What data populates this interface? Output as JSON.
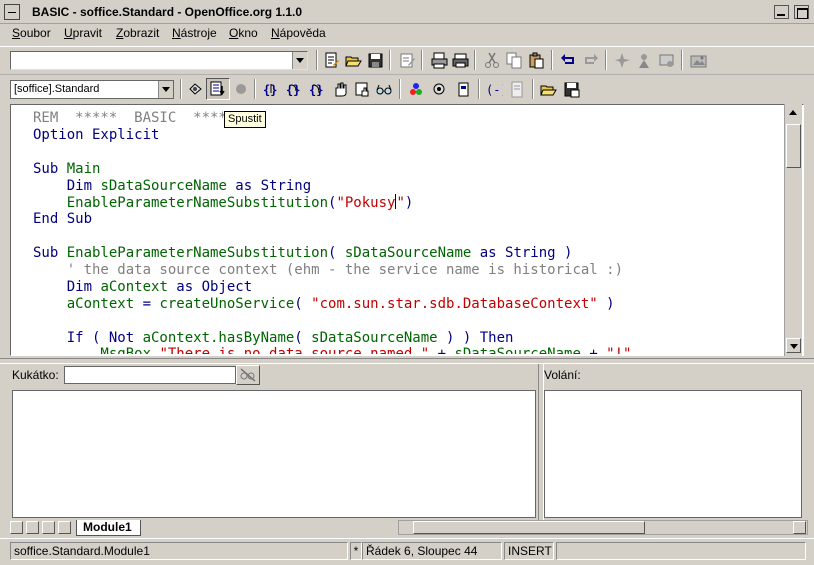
{
  "window": {
    "title": "BASIC - soffice.Standard - OpenOffice.org 1.1.0"
  },
  "menu": [
    {
      "label": "Soubor",
      "mnemonic": "S"
    },
    {
      "label": "Upravit",
      "mnemonic": "U"
    },
    {
      "label": "Zobrazit",
      "mnemonic": "Z"
    },
    {
      "label": "Nástroje",
      "mnemonic": "N"
    },
    {
      "label": "Okno",
      "mnemonic": "O"
    },
    {
      "label": "Nápověda",
      "mnemonic": "N"
    }
  ],
  "toolbar1": {
    "url_value": "",
    "icons": [
      "edit-file-icon",
      "open-icon",
      "save-icon",
      "edit-mode-icon",
      "print-file-icon",
      "print-icon",
      "cut-icon",
      "copy-icon",
      "paste-icon",
      "undo-icon",
      "redo-icon",
      "navigator-icon",
      "stylist-icon",
      "sources-icon",
      "gallery-icon"
    ]
  },
  "toolbar2": {
    "library_selected": "[soffice].Standard",
    "icons": [
      "compile-icon",
      "run-icon",
      "stop-icon",
      "step-procedure-icon",
      "step-into-icon",
      "step-out-icon",
      "breakpoint-icon",
      "manage-breakpoints-icon",
      "watch-icon",
      "find-parentheses-icon",
      "select-macro-icon",
      "modules-icon",
      "select-icon",
      "insert-source-icon",
      "save-source-icon"
    ]
  },
  "tooltip": "Spustit",
  "code_lines": [
    [
      {
        "t": "REM  *****  BASIC  *****",
        "c": "cm"
      }
    ],
    [
      {
        "t": "Option Explicit",
        "c": "kw"
      }
    ],
    [],
    [
      {
        "t": "Sub ",
        "c": "kw"
      },
      {
        "t": "Main",
        "c": "id"
      }
    ],
    [
      {
        "t": "    Dim ",
        "c": "kw"
      },
      {
        "t": "sDataSourceName ",
        "c": "id"
      },
      {
        "t": "as String",
        "c": "kw"
      }
    ],
    [
      {
        "t": "    ",
        "c": "id"
      },
      {
        "t": "EnableParameterNameSubstitution",
        "c": "id"
      },
      {
        "t": "(",
        "c": "kw"
      },
      {
        "t": "\"Pokusy",
        "c": "str"
      },
      {
        "t": "|",
        "c": "cursor"
      },
      {
        "t": "\"",
        "c": "str"
      },
      {
        "t": ")",
        "c": "kw"
      }
    ],
    [
      {
        "t": "End Sub",
        "c": "kw"
      }
    ],
    [],
    [
      {
        "t": "Sub ",
        "c": "kw"
      },
      {
        "t": "EnableParameterNameSubstitution",
        "c": "id"
      },
      {
        "t": "( ",
        "c": "kw"
      },
      {
        "t": "sDataSourceName ",
        "c": "id"
      },
      {
        "t": "as String )",
        "c": "kw"
      }
    ],
    [
      {
        "t": "    ' the data source context (ehm - the service name is historical :)",
        "c": "cm"
      }
    ],
    [
      {
        "t": "    Dim ",
        "c": "kw"
      },
      {
        "t": "aContext ",
        "c": "id"
      },
      {
        "t": "as Object",
        "c": "kw"
      }
    ],
    [
      {
        "t": "    aContext ",
        "c": "id"
      },
      {
        "t": "= ",
        "c": "kw"
      },
      {
        "t": "createUnoService",
        "c": "id"
      },
      {
        "t": "( ",
        "c": "kw"
      },
      {
        "t": "\"com.sun.star.sdb.DatabaseContext\"",
        "c": "str"
      },
      {
        "t": " )",
        "c": "kw"
      }
    ],
    [],
    [
      {
        "t": "    If ( Not ",
        "c": "kw"
      },
      {
        "t": "aContext.hasByName",
        "c": "id"
      },
      {
        "t": "( ",
        "c": "kw"
      },
      {
        "t": "sDataSourceName ",
        "c": "id"
      },
      {
        "t": ") ) Then",
        "c": "kw"
      }
    ],
    [
      {
        "t": "        MsgBox ",
        "c": "id"
      },
      {
        "t": "\"There is no data source named \"",
        "c": "str"
      },
      {
        "t": " + ",
        "c": "kw"
      },
      {
        "t": "sDataSourceName ",
        "c": "id"
      },
      {
        "t": "+ ",
        "c": "kw"
      },
      {
        "t": "\"!\"",
        "c": "str"
      }
    ]
  ],
  "watch": {
    "label": "Kukátko:",
    "input_value": ""
  },
  "calls": {
    "label": "Volání:"
  },
  "tabs": [
    {
      "label": "Module1",
      "active": true
    }
  ],
  "status": {
    "module": "soffice.Standard.Module1",
    "modified": "*",
    "position": "Řádek 6, Sloupec 44",
    "mode": "INSERT"
  },
  "colors": {
    "keyword": "#000080",
    "identifier": "#006400",
    "string": "#c00000",
    "comment": "#808080",
    "tooltip_bg": "#ffffe0"
  }
}
